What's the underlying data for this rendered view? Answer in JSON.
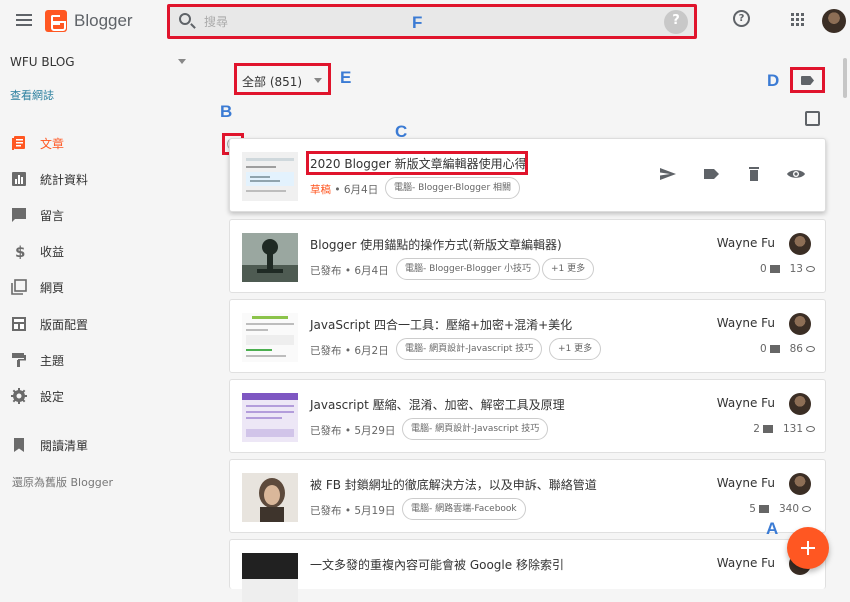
{
  "app": {
    "name": "Blogger"
  },
  "search": {
    "placeholder": "搜尋"
  },
  "sidebar": {
    "blog_name": "WFU BLOG",
    "view_blog": "查看網誌",
    "items": [
      {
        "label": "文章",
        "icon": "posts-icon",
        "active": true
      },
      {
        "label": "統計資料",
        "icon": "stats-icon"
      },
      {
        "label": "留言",
        "icon": "comments-icon"
      },
      {
        "label": "收益",
        "icon": "earnings-icon"
      },
      {
        "label": "網頁",
        "icon": "pages-icon"
      },
      {
        "label": "版面配置",
        "icon": "layout-icon"
      },
      {
        "label": "主題",
        "icon": "theme-icon"
      },
      {
        "label": "設定",
        "icon": "settings-icon"
      }
    ],
    "reading_list": "閱讀清單",
    "revert": "還原為舊版 Blogger"
  },
  "filter": {
    "selected": "全部 (851)"
  },
  "markers": {
    "a": "A",
    "b": "B",
    "c": "C",
    "d": "D",
    "e": "E",
    "f": "F"
  },
  "posts": [
    {
      "title": "2020 Blogger 新版文章編輯器使用心得",
      "status": "草稿",
      "date": "• 6月4日",
      "chips": [
        "電腦- Blogger-Blogger 相關"
      ]
    },
    {
      "title": "Blogger 使用錨點的操作方式(新版文章編輯器)",
      "status": "已發布",
      "date": "• 6月4日",
      "chips": [
        "電腦- Blogger-Blogger 小技巧",
        "+1 更多"
      ],
      "author": "Wayne Fu",
      "comments": "0",
      "views": "13"
    },
    {
      "title": "JavaScript 四合一工具：壓縮+加密+混淆+美化",
      "status": "已發布",
      "date": "• 6月2日",
      "chips": [
        "電腦- 網頁設計-Javascript 技巧",
        "+1 更多"
      ],
      "author": "Wayne Fu",
      "comments": "0",
      "views": "86"
    },
    {
      "title": "Javascript 壓縮、混淆、加密、解密工具及原理",
      "status": "已發布",
      "date": "• 5月29日",
      "chips": [
        "電腦- 網頁設計-Javascript 技巧"
      ],
      "author": "Wayne Fu",
      "comments": "2",
      "views": "131"
    },
    {
      "title": "被 FB 封鎖網址的徹底解決方法，以及申訴、聯絡管道",
      "status": "已發布",
      "date": "• 5月19日",
      "chips": [
        "電腦- 網路雲端-Facebook"
      ],
      "author": "Wayne Fu",
      "comments": "5",
      "views": "340"
    },
    {
      "title": "一文多發的重複內容可能會被 Google 移除索引",
      "author": "Wayne Fu"
    }
  ],
  "colors": {
    "accent": "#ff5722",
    "highlight": "#e0142c",
    "marker": "#3b7bd4"
  }
}
